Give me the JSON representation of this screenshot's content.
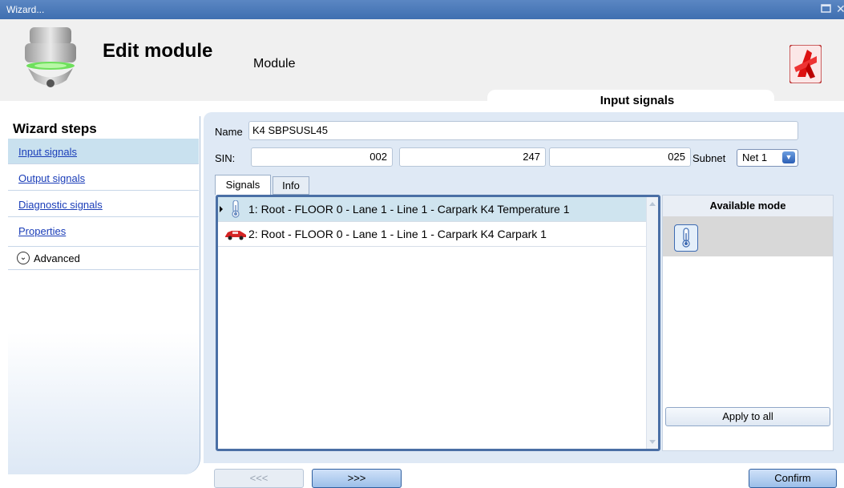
{
  "window": {
    "title": "Wizard..."
  },
  "header": {
    "title": "Edit module",
    "subtitle": "Module",
    "tab_caption": "Input signals"
  },
  "sidebar": {
    "title": "Wizard steps",
    "items": [
      {
        "label": "Input signals"
      },
      {
        "label": "Output signals"
      },
      {
        "label": "Diagnostic signals"
      },
      {
        "label": "Properties"
      }
    ],
    "advanced_label": "Advanced"
  },
  "form": {
    "name_label": "Name",
    "name_value": "K4 SBPSUSL45",
    "sin_label": "SIN:",
    "sin_values": [
      "002",
      "247",
      "025"
    ],
    "subnet_label": "Subnet",
    "subnet_value": "Net 1"
  },
  "tabs": [
    {
      "label": "Signals"
    },
    {
      "label": "Info"
    }
  ],
  "signals": [
    {
      "icon": "thermometer-icon",
      "label": "1: Root - FLOOR 0 - Lane 1 - Line 1 - Carpark K4 Temperature 1"
    },
    {
      "icon": "car-icon",
      "label": "2: Root - FLOOR 0 - Lane 1 - Line 1 - Carpark K4 Carpark 1"
    }
  ],
  "modes": {
    "header": "Available mode",
    "apply_label": "Apply to all"
  },
  "footer": {
    "prev_label": "<<<",
    "next_label": ">>>",
    "confirm_label": "Confirm"
  },
  "colors": {
    "titlebar": "#4a7bbd",
    "selected_row": "#cfe4ef",
    "panel": "#dfe9f5",
    "link": "#1a3db8"
  }
}
